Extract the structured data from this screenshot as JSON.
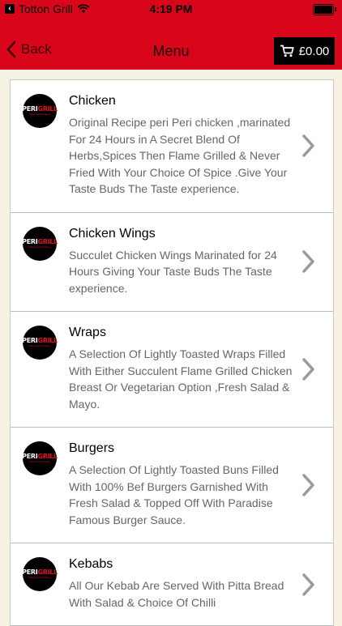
{
  "status_bar": {
    "carrier": "Totton Grill",
    "time": "4:19 PM"
  },
  "nav": {
    "back_label": "Back",
    "title": "Menu",
    "cart_total": "£0.00"
  },
  "logo": {
    "text_part1": "PERI",
    "text_part2": "GRILL",
    "subtext": "Flame Grill Chicken"
  },
  "menu_items": [
    {
      "title": "Chicken",
      "description": "Original Recipe peri Peri chicken ,marinated For 24 Hours in A Secret Blend Of Herbs,Spices Then Flame Grilled & Never Fried With Your Choice Of Spice .Give Your Taste Buds The Taste experience."
    },
    {
      "title": "Chicken Wings",
      "description": "Succulet Chicken Wings Marinated for 24 Hours Giving Your Taste Buds The  Taste experience."
    },
    {
      "title": "Wraps",
      "description": "A Selection Of Lightly Toasted Wraps Filled With Either Succulent Flame Grilled Chicken Breast Or Vegetarian Option ,Fresh Salad & Mayo."
    },
    {
      "title": "Burgers",
      "description": "A Selection Of Lightly Toasted Buns Filled With 100% Bef Burgers Garnished With Fresh Salad & Topped Off With Paradise Famous Burger Sauce."
    },
    {
      "title": "Kebabs",
      "description": "All Our Kebab Are Served With Pitta Bread With Salad & Choice Of Chilli"
    }
  ],
  "colors": {
    "brand_red": "#d9061b",
    "background": "#f7f1e3"
  }
}
